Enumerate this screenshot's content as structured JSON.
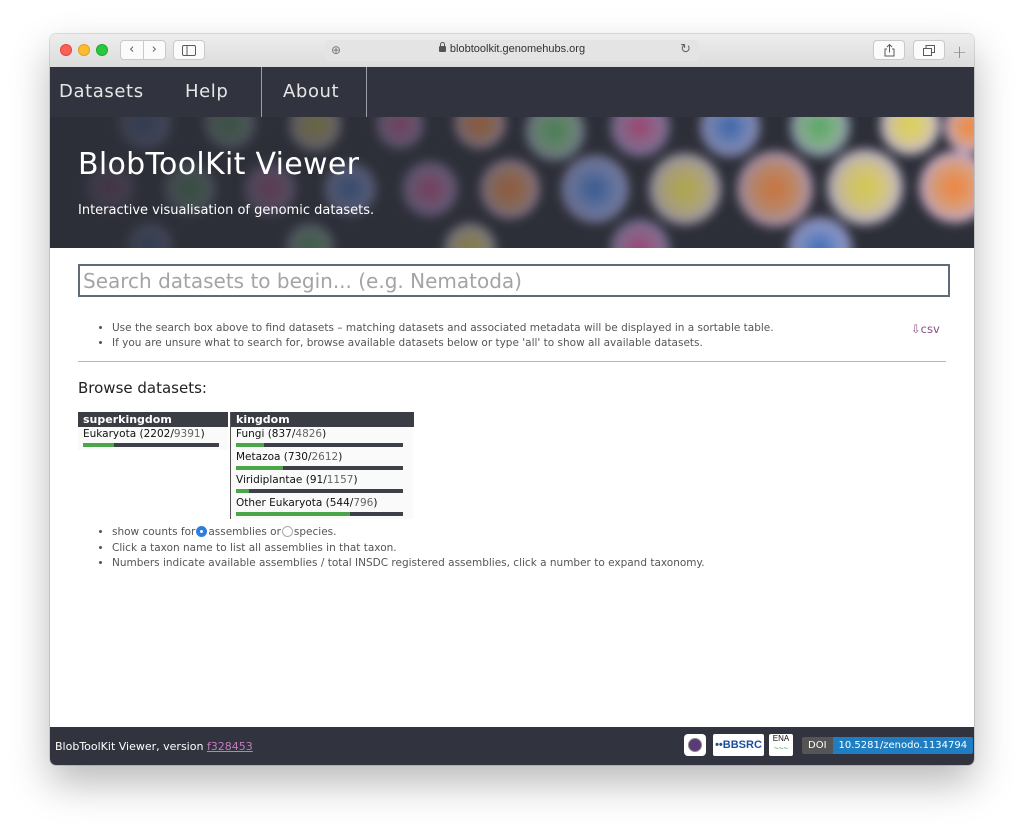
{
  "browser": {
    "url": "blobtoolkit.genomehubs.org",
    "back_glyph": "‹",
    "forward_glyph": "›",
    "reload_glyph": "↻",
    "new_tab_glyph": "+"
  },
  "nav": {
    "items": [
      {
        "label": "Datasets"
      },
      {
        "label": "Help"
      },
      {
        "label": "About"
      }
    ]
  },
  "hero": {
    "title": "BlobToolKit Viewer",
    "subtitle": "Interactive visualisation of genomic datasets."
  },
  "search": {
    "placeholder": "Search datasets to begin... (e.g. Nematoda)",
    "value": ""
  },
  "help": {
    "lines": [
      "Use the search box above to find datasets – matching datasets and associated metadata will be displayed in a sortable table.",
      "If you are unsure what to search for, browse available datasets below or type 'all' to show all available datasets."
    ],
    "csv_label": "⇩csv"
  },
  "browse": {
    "title": "Browse datasets:",
    "columns": [
      {
        "header": "superkingdom",
        "rows": [
          {
            "name": "Eukaryota",
            "available": "2202",
            "total": "9391",
            "fraction": 0.23
          }
        ]
      },
      {
        "header": "kingdom",
        "rows": [
          {
            "name": "Fungi",
            "available": "837",
            "total": "4826",
            "fraction": 0.17
          },
          {
            "name": "Metazoa",
            "available": "730",
            "total": "2612",
            "fraction": 0.28
          },
          {
            "name": "Viridiplantae",
            "available": "91",
            "total": "1157",
            "fraction": 0.08
          },
          {
            "name": "Other Eukaryota",
            "available": "544",
            "total": "796",
            "fraction": 0.68
          }
        ]
      }
    ],
    "options": {
      "show_counts_prefix": "show counts for",
      "assemblies_label": "assemblies or",
      "species_label": "species.",
      "selected": "assemblies",
      "line2": "Click a taxon name to list all assemblies in that taxon.",
      "line3": "Numbers indicate available assemblies / total INSDC registered assemblies, click a number to expand taxonomy."
    }
  },
  "footer": {
    "text": "BlobToolKit Viewer, version",
    "version": "f328453",
    "logos": {
      "bbsrc": "••BBSRC",
      "ena": "ENA",
      "ena_wave": "~~~"
    },
    "doi_key": "DOI",
    "doi_value": "10.5281/zenodo.1134794"
  },
  "colors": {
    "nav_bg": "#31333e",
    "accent_green": "#4ba64a",
    "link_purple": "#c47bc1",
    "doi_blue": "#1f7ec1"
  }
}
